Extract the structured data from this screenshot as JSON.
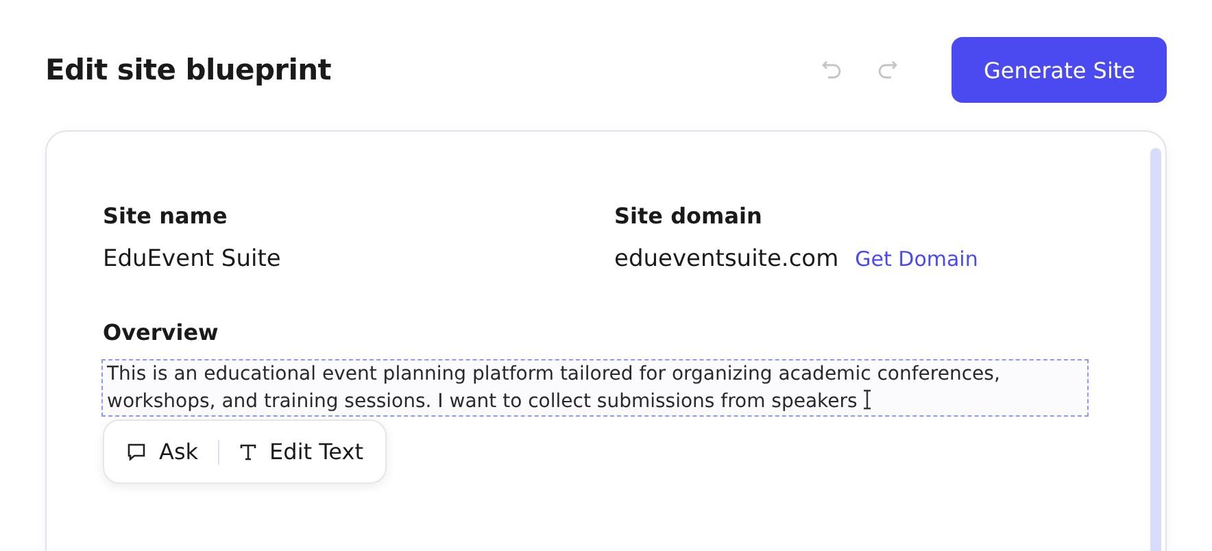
{
  "header": {
    "title": "Edit site blueprint",
    "undo": {
      "disabled": true
    },
    "redo": {
      "disabled": true
    },
    "primary_button": "Generate Site"
  },
  "site_name": {
    "label": "Site name",
    "value": "EduEvent Suite"
  },
  "site_domain": {
    "label": "Site domain",
    "value": "edueventsuite.com",
    "link": "Get Domain"
  },
  "overview": {
    "label": "Overview",
    "value": "This is an educational event planning platform tailored for organizing academic conferences, workshops, and training sessions. I want to collect submissions from speakers"
  },
  "text_toolbar": [
    {
      "kind": "ask",
      "label": "Ask"
    },
    {
      "kind": "edit",
      "label": "Edit Text"
    }
  ]
}
